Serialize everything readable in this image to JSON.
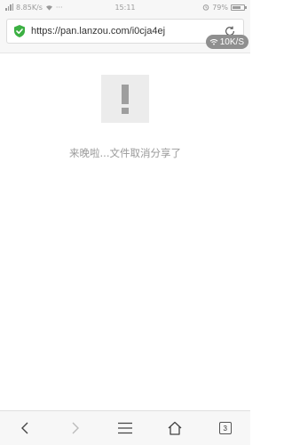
{
  "status_bar": {
    "network_speed": "8.85K/s",
    "time": "15:11",
    "battery_percent": "79%",
    "battery_level": 0.79
  },
  "address_bar": {
    "url": "https://pan.lanzou.com/i0cja4ej",
    "secure_icon": "green-shield-check-icon",
    "reload_icon": "reload-icon"
  },
  "speed_badge": {
    "text": "10K/S",
    "icon": "wifi-icon"
  },
  "content": {
    "notice_icon": "exclamation-icon",
    "message": "来晚啦...文件取消分享了"
  },
  "toolbar": {
    "back_icon": "chevron-left-icon",
    "forward_icon": "chevron-right-icon",
    "menu_icon": "menu-icon",
    "home_icon": "home-icon",
    "tab_count": "3"
  },
  "colors": {
    "shield_green": "#3cb043",
    "badge_bg": "#8f8f8f",
    "message_text": "#9a9a9a"
  }
}
